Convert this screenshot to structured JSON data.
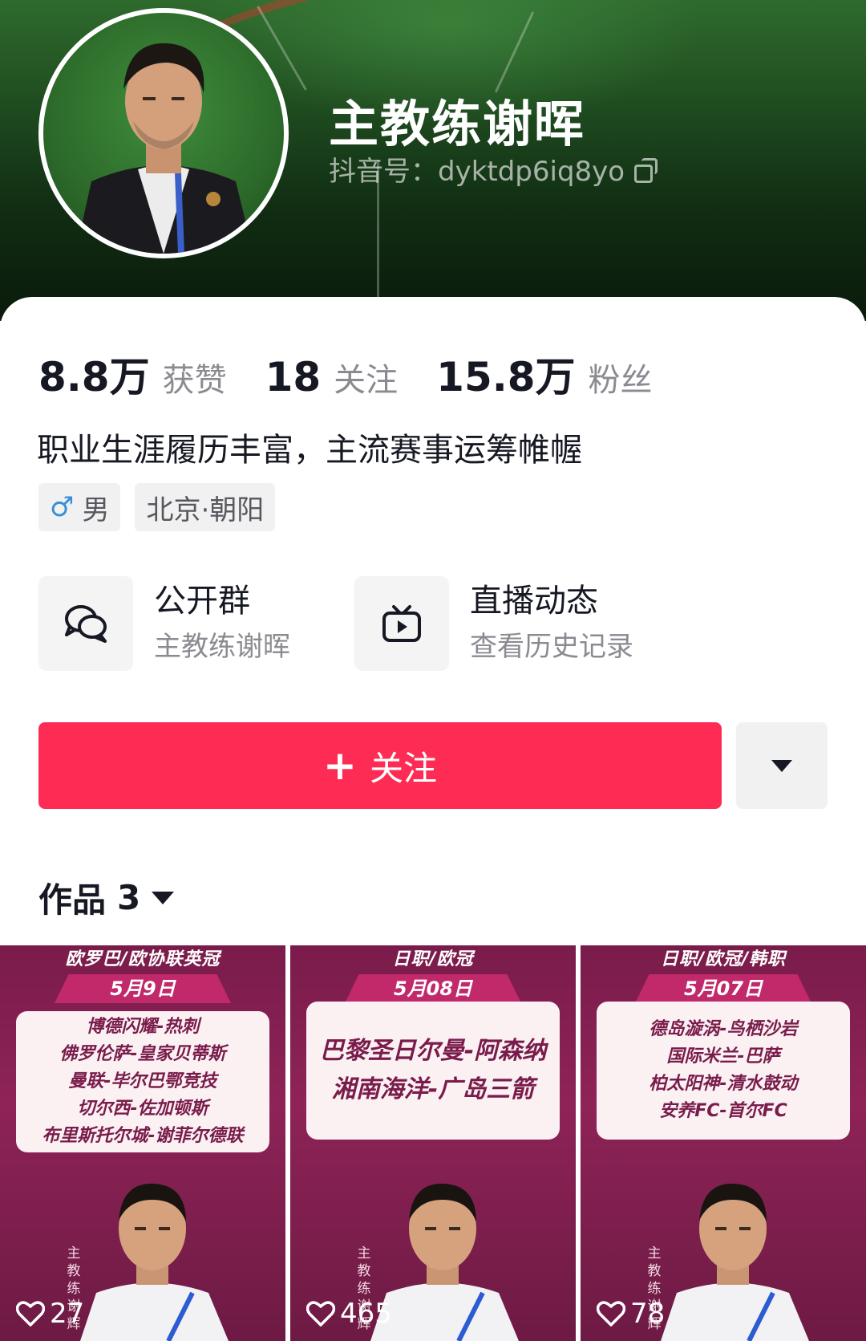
{
  "profile": {
    "name": "主教练谢晖",
    "douyin_id": "抖音号：dyktdp6iq8yo",
    "avatar_icon": "avatar-photo"
  },
  "stats": [
    {
      "value": "8.8万",
      "label": "获赞"
    },
    {
      "value": "18",
      "label": "关注"
    },
    {
      "value": "15.8万",
      "label": "粉丝"
    }
  ],
  "bio": "职业生涯履历丰富，主流赛事运筹帷幄",
  "tags": {
    "gender_symbol": "♂",
    "gender": "男",
    "location": "北京·朝阳"
  },
  "links": [
    {
      "title": "公开群",
      "subtitle": "主教练谢晖",
      "icon": "chat-bubbles-icon"
    },
    {
      "title": "直播动态",
      "subtitle": "查看历史记录",
      "icon": "tv-play-icon"
    }
  ],
  "actions": {
    "follow_label": "关注",
    "follow_color": "#fe2c55"
  },
  "works": {
    "label": "作品",
    "count": "3"
  },
  "videos": [
    {
      "header": "欧罗巴/欧协联英冠",
      "date": "5月9日",
      "matches": [
        "博德闪耀-热刺",
        "佛罗伦萨-皇家贝蒂斯",
        "曼联-毕尔巴鄂竞技",
        "切尔西-佐加顿斯",
        "布里斯托尔城-谢菲尔德联"
      ],
      "side": "主教练谢辉",
      "likes": "27"
    },
    {
      "header": "日职/欧冠",
      "date": "5月08日",
      "matches": [
        "巴黎圣日尔曼-阿森纳",
        "湘南海洋-广岛三箭"
      ],
      "side": "主教练谢辉",
      "likes": "465"
    },
    {
      "header": "日职/欧冠/韩职",
      "date": "5月07日",
      "matches": [
        "德岛漩涡-鸟栖沙岩",
        "国际米兰-巴萨",
        "柏太阳神-清水鼓动",
        "安养FC-首尔FC"
      ],
      "side": "主教练谢辉",
      "likes": "78"
    }
  ]
}
